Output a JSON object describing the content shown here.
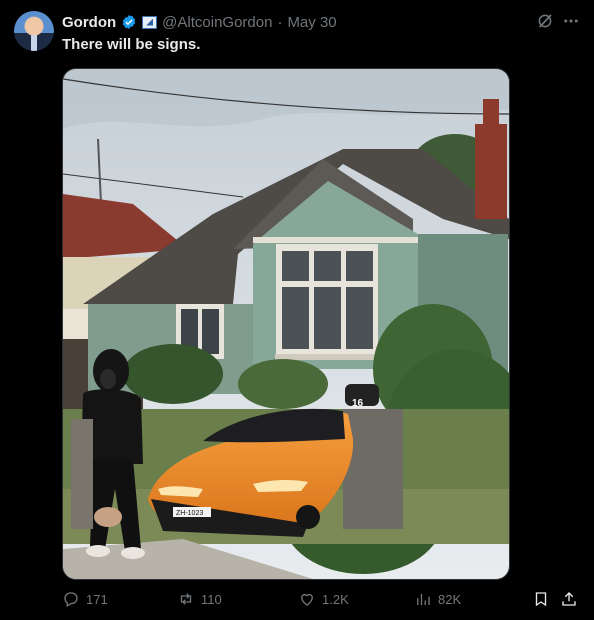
{
  "tweet": {
    "author_name": "Gordon",
    "handle": "@AltcoinGordon",
    "separator": "·",
    "date": "May 30",
    "text": "There will be signs."
  },
  "media": {
    "plate": "ZH-1023",
    "mailbox_number": "16"
  },
  "actions": {
    "replies": "171",
    "reposts": "110",
    "likes": "1.2K",
    "views": "82K"
  },
  "colors": {
    "background": "#000000",
    "text_primary": "#e7e9ea",
    "text_secondary": "#71767b",
    "verified_badge": "#1d9bf0"
  },
  "icons": [
    "verified-badge-icon",
    "affiliate-badge-icon",
    "grok-icon",
    "more-icon",
    "reply-icon",
    "repost-icon",
    "like-icon",
    "views-icon",
    "bookmark-icon",
    "share-icon"
  ]
}
